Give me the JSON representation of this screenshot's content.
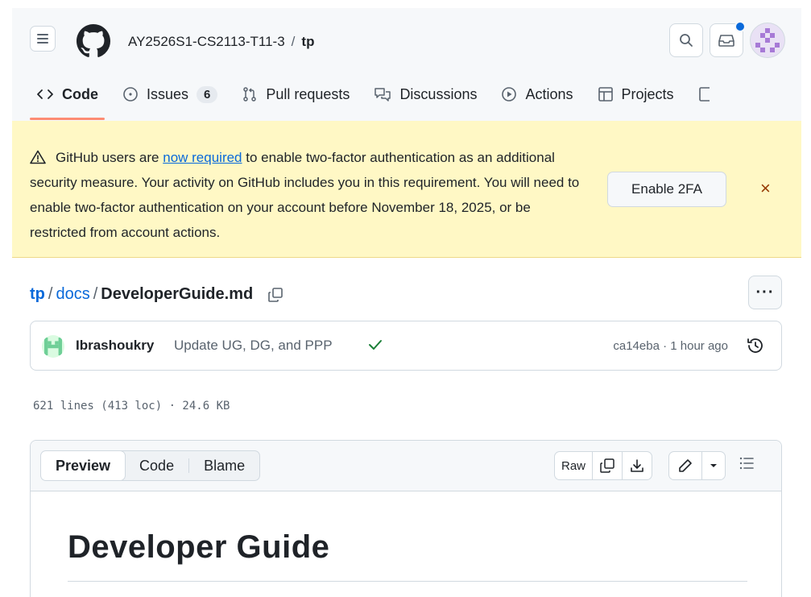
{
  "header": {
    "org": "AY2526S1-CS2113-T11-3",
    "separator": "/",
    "repo": "tp"
  },
  "tabs": [
    {
      "label": "Code",
      "icon": "code-icon"
    },
    {
      "label": "Issues",
      "icon": "issue-icon",
      "count": "6"
    },
    {
      "label": "Pull requests",
      "icon": "pull-request-icon"
    },
    {
      "label": "Discussions",
      "icon": "discussion-icon"
    },
    {
      "label": "Actions",
      "icon": "play-icon"
    },
    {
      "label": "Projects",
      "icon": "table-icon"
    }
  ],
  "banner": {
    "text_before": "GitHub users are ",
    "link": "now required",
    "text_after": " to enable two-factor authentication as an additional security measure. Your activity on GitHub includes you in this requirement. You will need to enable two-factor authentication on your account before November 18, 2025, or be restricted from account actions.",
    "button": "Enable 2FA",
    "close": "×"
  },
  "breadcrumb": {
    "root": "tp",
    "folder": "docs",
    "file": "DeveloperGuide.md",
    "sep": "/"
  },
  "more_label": "···",
  "commit": {
    "author": "Ibrashoukry",
    "message": "Update UG, DG, and PPP",
    "hash_time": "ca14eba · 1 hour ago"
  },
  "file_info": "621 lines (413 loc) · 24.6 KB",
  "file_tabs": [
    "Preview",
    "Code",
    "Blame"
  ],
  "toolbar": {
    "raw": "Raw"
  },
  "markdown": {
    "title": "Developer Guide"
  },
  "colors": {
    "accent": "#fd8c73",
    "link": "#0969da",
    "banner_bg": "#fff8c5",
    "success": "#1a7f37"
  }
}
